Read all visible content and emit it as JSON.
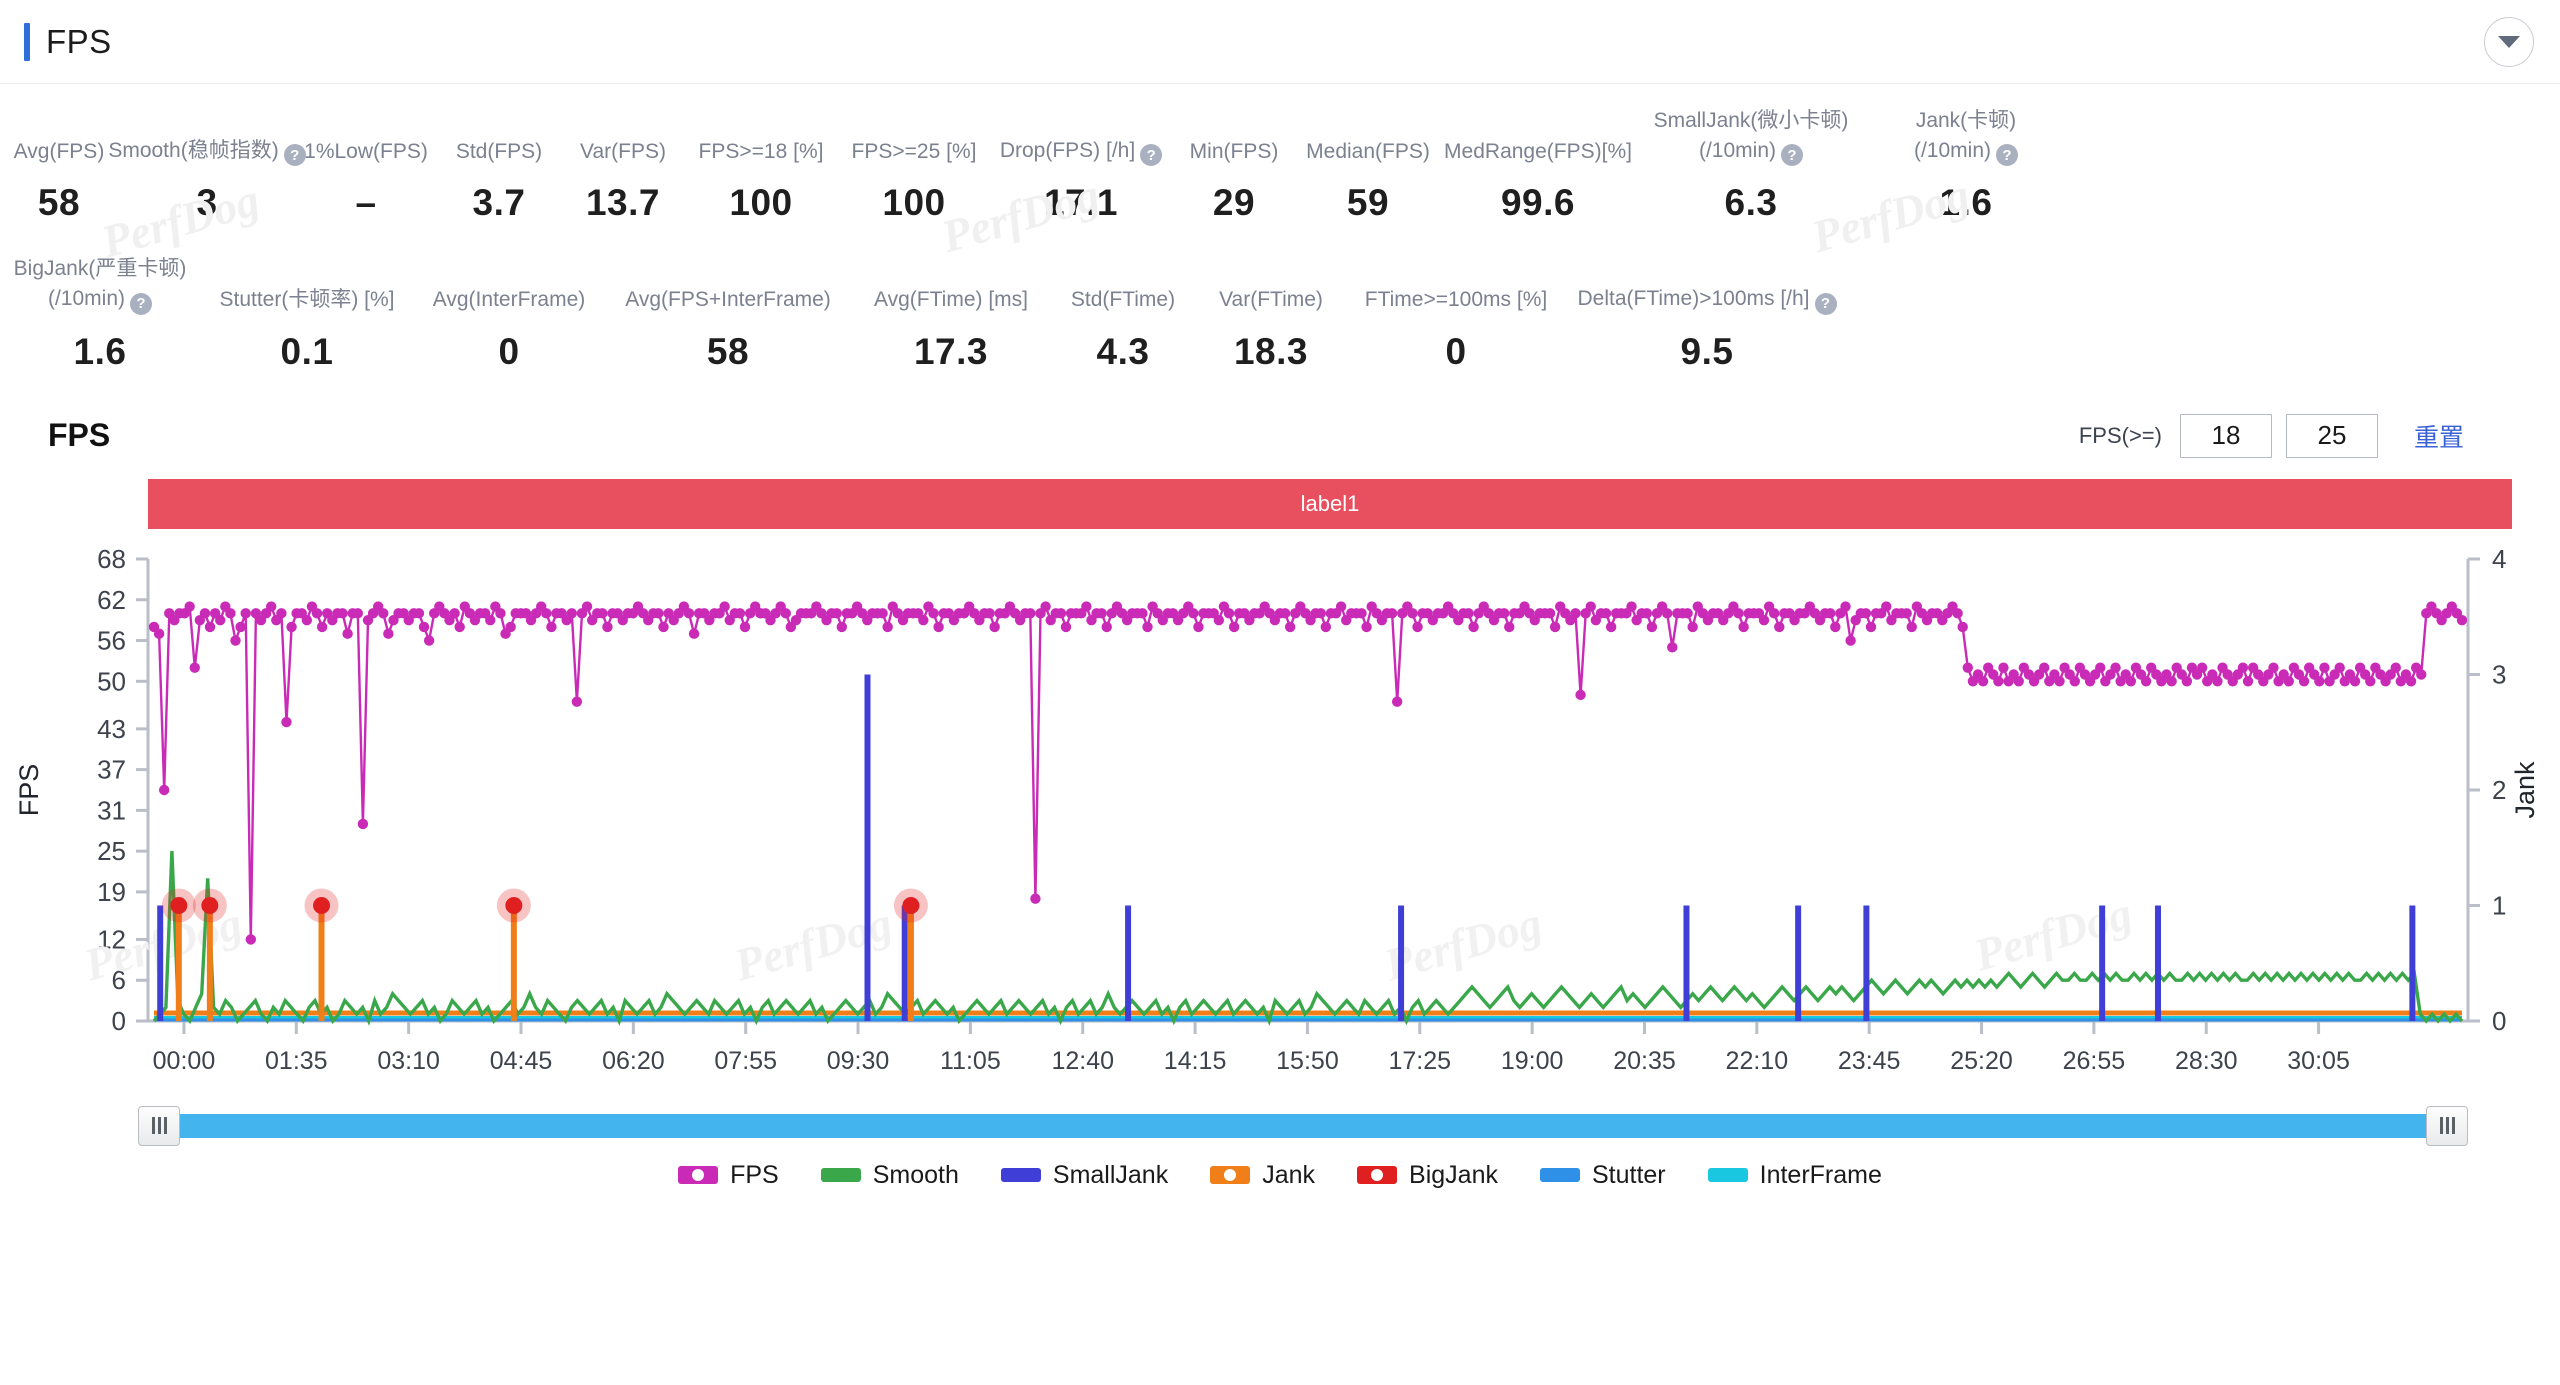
{
  "header": {
    "title": "FPS",
    "collapse_icon": "chevron-down-icon",
    "accent_color": "#2f6fd8"
  },
  "metrics_row1": [
    {
      "label": "Avg(FPS)",
      "value": "58",
      "help": false
    },
    {
      "label": "Smooth(稳帧指数)",
      "value": "3",
      "help": true
    },
    {
      "label": "1%Low(FPS)",
      "value": "–",
      "help": false
    },
    {
      "label": "Std(FPS)",
      "value": "3.7",
      "help": false
    },
    {
      "label": "Var(FPS)",
      "value": "13.7",
      "help": false
    },
    {
      "label": "FPS>=18 [%]",
      "value": "100",
      "help": false
    },
    {
      "label": "FPS>=25 [%]",
      "value": "100",
      "help": false
    },
    {
      "label": "Drop(FPS) [/h]",
      "value": "17.1",
      "help": true
    },
    {
      "label": "Min(FPS)",
      "value": "29",
      "help": false
    },
    {
      "label": "Median(FPS)",
      "value": "59",
      "help": false
    },
    {
      "label": "MedRange(FPS)[%]",
      "value": "99.6",
      "help": false
    },
    {
      "label": "SmallJank(微小卡顿)",
      "label2": "(/10min)",
      "value": "6.3",
      "help": true
    },
    {
      "label": "Jank(卡顿)",
      "label2": "(/10min)",
      "value": "1.6",
      "help": true
    }
  ],
  "metrics_row2": [
    {
      "label": "BigJank(严重卡顿)",
      "label2": "(/10min)",
      "value": "1.6",
      "help": true
    },
    {
      "label": "Stutter(卡顿率) [%]",
      "value": "0.1",
      "help": false
    },
    {
      "label": "Avg(InterFrame)",
      "value": "0",
      "help": false
    },
    {
      "label": "Avg(FPS+InterFrame)",
      "value": "58",
      "help": false
    },
    {
      "label": "Avg(FTime) [ms]",
      "value": "17.3",
      "help": false
    },
    {
      "label": "Std(FTime)",
      "value": "4.3",
      "help": false
    },
    {
      "label": "Var(FTime)",
      "value": "18.3",
      "help": false
    },
    {
      "label": "FTime>=100ms [%]",
      "value": "0",
      "help": false
    },
    {
      "label": "Delta(FTime)>100ms [/h]",
      "value": "9.5",
      "help": true
    }
  ],
  "watermarks": [
    "PerfDog",
    "PerfDog",
    "PerfDog",
    "PerfDog"
  ],
  "chart_header": {
    "title": "FPS",
    "threshold_label": "FPS(>=)",
    "threshold_low": "18",
    "threshold_high": "25",
    "reset_label": "重置"
  },
  "label_bar": {
    "text": "label1",
    "color": "#e8505f"
  },
  "scrollbar": {
    "track_color": "#44b4ef",
    "left_handle_icon": "grip-handle-icon",
    "right_handle_icon": "grip-handle-icon"
  },
  "legend": [
    {
      "name": "FPS",
      "color": "#c92bb7",
      "marker": "dotted"
    },
    {
      "name": "Smooth",
      "color": "#3aa84a",
      "marker": "line"
    },
    {
      "name": "SmallJank",
      "color": "#3f3fd8",
      "marker": "line"
    },
    {
      "name": "Jank",
      "color": "#f07f1a",
      "marker": "dotted"
    },
    {
      "name": "BigJank",
      "color": "#e02020",
      "marker": "dotted"
    },
    {
      "name": "Stutter",
      "color": "#2f90e8",
      "marker": "line"
    },
    {
      "name": "InterFrame",
      "color": "#19c8e0",
      "marker": "line"
    }
  ],
  "chart_data": {
    "type": "line",
    "title": "FPS",
    "xlabel": "",
    "ylabel": "FPS",
    "y2label": "Jank",
    "grid": false,
    "legend_position": "bottom",
    "ylim": [
      0,
      68
    ],
    "y2lim": [
      0,
      4
    ],
    "yticks": [
      0,
      6,
      12,
      19,
      25,
      31,
      37,
      43,
      50,
      56,
      62,
      68
    ],
    "y2ticks": [
      0,
      1,
      2,
      3,
      4
    ],
    "xticks": [
      "00:00",
      "01:35",
      "03:10",
      "04:45",
      "06:20",
      "07:55",
      "09:30",
      "11:05",
      "12:40",
      "14:15",
      "15:50",
      "17:25",
      "19:00",
      "20:35",
      "22:10",
      "23:45",
      "25:20",
      "26:55",
      "28:30",
      "30:05"
    ],
    "xlim": [
      "00:00",
      "31:00"
    ],
    "series": [
      {
        "name": "FPS",
        "axis": "left",
        "color": "#c92bb7",
        "marker": "circle",
        "description": "Frame rate samples, mostly 56-62 fps with periodic sharp drops; last third settles near 50-52 fps then recovers to ~60 at the end.",
        "values": [
          58,
          57,
          34,
          60,
          59,
          60,
          60,
          61,
          52,
          59,
          60,
          58,
          60,
          59,
          61,
          60,
          56,
          58,
          60,
          12,
          60,
          59,
          60,
          61,
          59,
          60,
          44,
          58,
          60,
          60,
          59,
          61,
          60,
          58,
          60,
          59,
          60,
          60,
          57,
          60,
          60,
          29,
          59,
          60,
          61,
          60,
          57,
          59,
          60,
          60,
          59,
          60,
          60,
          58,
          56,
          60,
          61,
          60,
          59,
          60,
          58,
          61,
          60,
          59,
          60,
          60,
          59,
          61,
          60,
          57,
          58,
          60,
          60,
          60,
          59,
          60,
          61,
          60,
          58,
          60,
          60,
          59,
          60,
          47,
          60,
          61,
          59,
          60,
          60,
          58,
          60,
          60,
          59,
          60,
          60,
          61,
          60,
          59,
          60,
          60,
          58,
          60,
          59,
          60,
          61,
          60,
          57,
          60,
          60,
          59,
          60,
          60,
          61,
          59,
          60,
          60,
          58,
          60,
          61,
          60,
          60,
          59,
          60,
          61,
          60,
          58,
          59,
          60,
          60,
          60,
          61,
          60,
          59,
          60,
          60,
          58,
          60,
          60,
          61,
          60,
          59,
          60,
          60,
          60,
          58,
          61,
          60,
          59,
          60,
          60,
          60,
          59,
          61,
          60,
          58,
          60,
          60,
          59,
          60,
          60,
          61,
          60,
          59,
          60,
          60,
          58,
          60,
          60,
          61,
          60,
          59,
          60,
          60,
          18,
          60,
          61,
          59,
          60,
          60,
          58,
          60,
          60,
          60,
          61,
          59,
          60,
          60,
          58,
          60,
          61,
          60,
          59,
          60,
          60,
          60,
          58,
          61,
          60,
          59,
          60,
          60,
          59,
          60,
          61,
          60,
          58,
          60,
          60,
          60,
          59,
          61,
          60,
          58,
          60,
          60,
          59,
          60,
          60,
          61,
          60,
          59,
          60,
          60,
          58,
          60,
          61,
          60,
          59,
          60,
          60,
          58,
          60,
          60,
          61,
          59,
          60,
          60,
          60,
          58,
          61,
          60,
          59,
          60,
          60,
          47,
          60,
          61,
          60,
          58,
          60,
          60,
          59,
          60,
          60,
          61,
          60,
          59,
          60,
          60,
          58,
          60,
          61,
          60,
          59,
          60,
          60,
          58,
          60,
          60,
          61,
          60,
          59,
          60,
          60,
          60,
          58,
          61,
          60,
          59,
          60,
          48,
          60,
          61,
          59,
          60,
          60,
          58,
          60,
          60,
          60,
          61,
          59,
          60,
          60,
          58,
          60,
          61,
          60,
          55,
          60,
          60,
          60,
          58,
          61,
          60,
          59,
          60,
          60,
          59,
          60,
          61,
          60,
          58,
          60,
          60,
          60,
          59,
          61,
          60,
          58,
          60,
          60,
          59,
          60,
          60,
          61,
          60,
          59,
          60,
          60,
          58,
          60,
          61,
          56,
          59,
          60,
          60,
          58,
          60,
          60,
          61,
          59,
          60,
          60,
          60,
          58,
          61,
          60,
          59,
          60,
          60,
          59,
          60,
          61,
          60,
          58,
          52,
          50,
          51,
          50,
          52,
          51,
          50,
          52,
          50,
          51,
          50,
          52,
          51,
          50,
          51,
          52,
          50,
          51,
          50,
          52,
          51,
          50,
          52,
          51,
          50,
          51,
          52,
          50,
          51,
          52,
          50,
          51,
          50,
          52,
          51,
          50,
          52,
          51,
          50,
          51,
          50,
          52,
          51,
          50,
          52,
          51,
          52,
          50,
          51,
          50,
          52,
          51,
          50,
          51,
          52,
          50,
          52,
          51,
          50,
          51,
          52,
          50,
          51,
          50,
          52,
          51,
          50,
          52,
          51,
          50,
          52,
          50,
          51,
          52,
          50,
          51,
          50,
          52,
          51,
          50,
          52,
          51,
          50,
          51,
          52,
          50,
          51,
          50,
          52,
          51,
          60,
          61,
          60,
          59,
          60,
          61,
          60,
          59
        ]
      },
      {
        "name": "Smooth",
        "axis": "left",
        "color": "#3aa84a",
        "marker": "none",
        "description": "Smooth index, a noisy low band mostly 0-5 rising slightly toward 6-7 at the right; occasional spikes to 19-25.",
        "values": [
          0,
          1,
          2,
          25,
          3,
          1,
          0,
          2,
          4,
          21,
          2,
          1,
          3,
          2,
          0,
          1,
          2,
          3,
          1,
          0,
          2,
          1,
          3,
          2,
          1,
          0,
          2,
          3,
          1,
          2,
          0,
          1,
          3,
          2,
          1,
          2,
          0,
          3,
          1,
          2,
          4,
          3,
          2,
          1,
          2,
          3,
          1,
          2,
          0,
          1,
          3,
          2,
          1,
          2,
          3,
          1,
          2,
          0,
          1,
          2,
          3,
          1,
          2,
          4,
          2,
          1,
          3,
          2,
          1,
          0,
          2,
          3,
          2,
          1,
          2,
          3,
          1,
          2,
          0,
          3,
          2,
          1,
          2,
          3,
          1,
          2,
          4,
          3,
          2,
          1,
          2,
          3,
          2,
          1,
          3,
          2,
          1,
          2,
          3,
          1,
          2,
          0,
          2,
          3,
          1,
          2,
          3,
          2,
          1,
          2,
          3,
          1,
          2,
          0,
          1,
          2,
          3,
          2,
          1,
          2,
          3,
          1,
          2,
          4,
          3,
          2,
          1,
          2,
          3,
          1,
          2,
          3,
          2,
          1,
          2,
          0,
          1,
          2,
          3,
          2,
          1,
          2,
          3,
          1,
          2,
          3,
          2,
          1,
          2,
          3,
          1,
          2,
          0,
          2,
          3,
          1,
          2,
          3,
          1,
          2,
          4,
          2,
          1,
          2,
          3,
          2,
          1,
          2,
          3,
          1,
          2,
          0,
          2,
          3,
          1,
          2,
          3,
          2,
          1,
          2,
          3,
          1,
          2,
          3,
          2,
          1,
          2,
          0,
          3,
          2,
          1,
          2,
          3,
          1,
          2,
          4,
          3,
          2,
          1,
          2,
          3,
          2,
          1,
          3,
          2,
          1,
          2,
          3,
          1,
          2,
          0,
          2,
          3,
          1,
          2,
          3,
          2,
          1,
          2,
          3,
          4,
          5,
          4,
          3,
          2,
          3,
          4,
          5,
          3,
          2,
          3,
          4,
          3,
          2,
          3,
          4,
          5,
          4,
          3,
          2,
          3,
          4,
          3,
          2,
          3,
          4,
          5,
          3,
          4,
          3,
          2,
          3,
          4,
          5,
          4,
          3,
          2,
          3,
          4,
          3,
          4,
          5,
          4,
          3,
          4,
          5,
          4,
          3,
          4,
          3,
          2,
          3,
          4,
          5,
          4,
          3,
          4,
          5,
          4,
          3,
          4,
          5,
          4,
          5,
          4,
          3,
          4,
          5,
          6,
          5,
          4,
          5,
          6,
          5,
          4,
          5,
          6,
          5,
          6,
          5,
          4,
          5,
          6,
          5,
          6,
          5,
          6,
          5,
          6,
          5,
          6,
          7,
          6,
          5,
          6,
          7,
          6,
          5,
          6,
          7,
          6,
          6,
          7,
          6,
          6,
          7,
          6,
          7,
          6,
          7,
          6,
          6,
          7,
          6,
          7,
          6,
          7,
          6,
          7,
          6,
          6,
          7,
          6,
          7,
          6,
          7,
          6,
          7,
          6,
          7,
          6,
          6,
          7,
          6,
          7,
          6,
          7,
          6,
          7,
          6,
          7,
          6,
          7,
          6,
          7,
          6,
          7,
          6,
          7,
          6,
          6,
          7,
          6,
          7,
          6,
          7,
          6,
          7,
          6,
          7,
          1,
          0,
          1,
          0,
          1,
          0,
          1,
          0
        ]
      },
      {
        "name": "SmallJank",
        "axis": "right",
        "color": "#3f3fd8",
        "marker": "none",
        "description": "Small jank events, discrete spikes reaching 1 on the Jank axis (one tall spike near 09:30 reaching ~3).",
        "event_times": [
          "00:05",
          "09:35",
          "10:05",
          "13:05",
          "16:45",
          "20:35",
          "22:05",
          "23:00",
          "26:10",
          "26:55",
          "30:20"
        ],
        "event_values": [
          1,
          3,
          1,
          1,
          1,
          1,
          1,
          1,
          1,
          1,
          1
        ]
      },
      {
        "name": "Jank",
        "axis": "right",
        "color": "#f07f1a",
        "marker": "circle",
        "description": "Jank events at value 1 on the Jank axis.",
        "event_times": [
          "00:20",
          "00:45",
          "02:15",
          "04:50",
          "10:10"
        ],
        "event_values": [
          1,
          1,
          1,
          1,
          1
        ]
      },
      {
        "name": "BigJank",
        "axis": "right",
        "color": "#e02020",
        "marker": "circle-halo",
        "description": "Severe jank markers, highlighted red dots at value 1 on the Jank axis.",
        "event_times": [
          "00:20",
          "00:45",
          "02:15",
          "04:50",
          "10:10"
        ],
        "event_values": [
          1,
          1,
          1,
          1,
          1
        ]
      },
      {
        "name": "Stutter",
        "axis": "right",
        "color": "#2f90e8",
        "marker": "none",
        "description": "Stutter rate, flat near 0 across the whole trace.",
        "values": [
          0
        ]
      },
      {
        "name": "InterFrame",
        "axis": "right",
        "color": "#19c8e0",
        "marker": "none",
        "description": "InterFrame count, flat at 0 across the whole trace.",
        "values": [
          0
        ]
      }
    ]
  }
}
